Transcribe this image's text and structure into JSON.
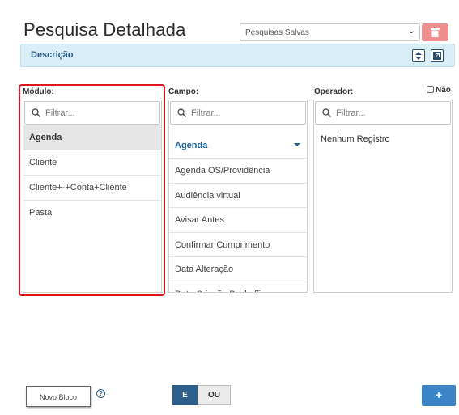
{
  "page": {
    "title": "Pesquisa Detalhada"
  },
  "saved_searches": {
    "selected": "Pesquisas Salvas"
  },
  "description": {
    "label": "Descrição"
  },
  "labels": {
    "modulo": "Módulo:",
    "campo": "Campo:",
    "operador": "Operador:",
    "nao": "Não"
  },
  "filter_placeholder": "Filtrar...",
  "modules": {
    "items": [
      {
        "label": "Agenda",
        "active": true
      },
      {
        "label": "Cliente"
      },
      {
        "label": "Cliente+-+Conta+Cliente"
      },
      {
        "label": "Pasta"
      }
    ]
  },
  "fields": {
    "group": "Agenda",
    "items": [
      "Agenda OS/Providência",
      "Audiência virtual",
      "Avisar Antes",
      "Confirmar Cumprimento",
      "Data Alteração",
      "Data Criação Backoffice"
    ]
  },
  "operators": {
    "empty": "Nenhum Registro"
  },
  "footer": {
    "novo_bloco": "Novo Bloco",
    "help": "?",
    "e": "E",
    "ou": "OU",
    "add": "+"
  },
  "colors": {
    "accent": "#2d5f8c",
    "add_button": "#3a86c8",
    "delete": "#ef8e8e",
    "highlight": "#e0141c",
    "desc_bar": "#d8eef7"
  },
  "icons": {
    "delete": "trash-icon",
    "filter": "search-icon",
    "sort": "sort-icon",
    "expand": "expand-icon"
  }
}
